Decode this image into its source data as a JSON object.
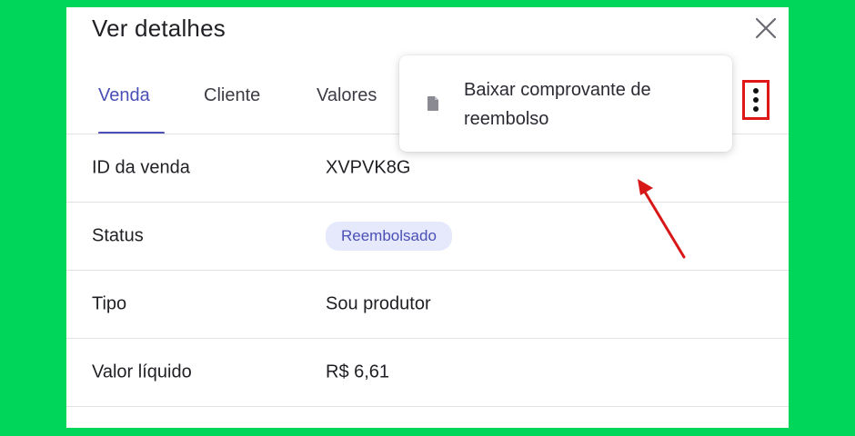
{
  "modal": {
    "title": "Ver detalhes",
    "close_icon": "close-icon"
  },
  "tabs": [
    {
      "label": "Venda",
      "active": true
    },
    {
      "label": "Cliente",
      "active": false
    },
    {
      "label": "Valores",
      "active": false
    }
  ],
  "menu": {
    "trigger_icon": "kebab-vertical-icon",
    "items": [
      {
        "label": "Baixar comprovante de reembolso",
        "icon": "document-icon"
      }
    ]
  },
  "details": [
    {
      "label": "ID da venda",
      "value": "XVPVK8G"
    },
    {
      "label": "Status",
      "value": "Reembolsado"
    },
    {
      "label": "Tipo",
      "value": "Sou produtor"
    },
    {
      "label": "Valor líquido",
      "value": "R$ 6,61"
    }
  ],
  "colors": {
    "background": "#00d65a",
    "accent": "#4a4fb5",
    "badge_bg": "#e6e9fb",
    "highlight": "#e01717"
  }
}
